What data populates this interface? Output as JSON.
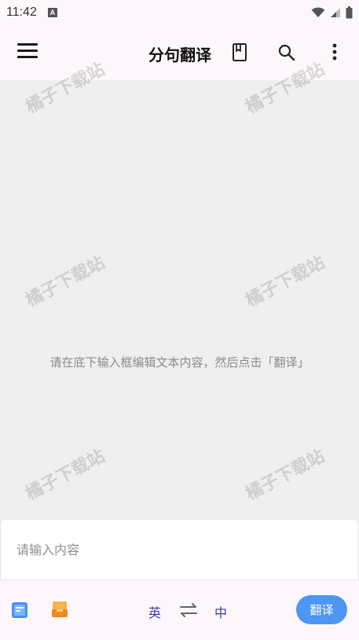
{
  "status_bar": {
    "time": "11:42",
    "indicator": "A",
    "icons": [
      "wifi-icon",
      "signal-icon",
      "battery-icon"
    ]
  },
  "app_bar": {
    "title": "分句翻译",
    "icons": [
      "menu-icon",
      "book-icon",
      "search-icon",
      "more-vert-icon"
    ]
  },
  "content": {
    "hint": "请在底下输入框编辑文本内容，然后点击「翻译」"
  },
  "input": {
    "placeholder": "请输入内容",
    "value": ""
  },
  "bottom_bar": {
    "source_lang": "英",
    "target_lang": "中",
    "translate_label": "翻译",
    "icons": [
      "document-icon",
      "inbox-icon",
      "swap-icon"
    ]
  },
  "watermark": {
    "text": "橘子下载站"
  },
  "colors": {
    "accent": "#4d96f2",
    "lang_text": "#3b3a9a",
    "content_bg": "#efefef",
    "bar_bg": "#fdf7fb",
    "doc_icon": "#4a8ff0",
    "box_icon": "#f5a623"
  }
}
